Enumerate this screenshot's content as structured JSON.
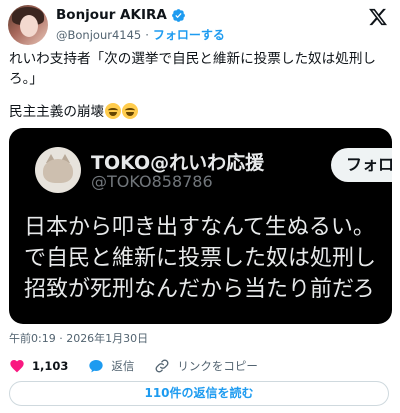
{
  "author": {
    "name": "Bonjour AKIRA",
    "handle": "@Bonjour4145",
    "separator": "·",
    "follow_label": "フォローする"
  },
  "tweet": {
    "line1": "れいわ支持者「次の選挙で自民と維新に投票した奴は処刑しろ。」",
    "line2": "民主主義の崩壊"
  },
  "embedded": {
    "name": "TOKO@れいわ応援",
    "handle": "@TOKO858786",
    "follow_label": "フォロ",
    "lines": [
      "日本から叩き出すなんて生ぬるい。",
      "で自民と維新に投票した奴は処刑し",
      "招致が死刑なんだから当たり前だろ"
    ]
  },
  "meta": {
    "timestamp": "午前0:19 · 2026年1月30日"
  },
  "actions": {
    "likes": "1,103",
    "reply_label": "返信",
    "copy_link_label": "リンクをコピー"
  },
  "replies_button": "110件の返信を読む",
  "colors": {
    "accent": "#1d9bf0",
    "like": "#f91880",
    "muted": "#536471"
  },
  "icons": [
    "verified-badge-icon",
    "x-logo-icon",
    "heart-icon",
    "reply-icon",
    "link-icon",
    "laughing-emoji-icon"
  ]
}
